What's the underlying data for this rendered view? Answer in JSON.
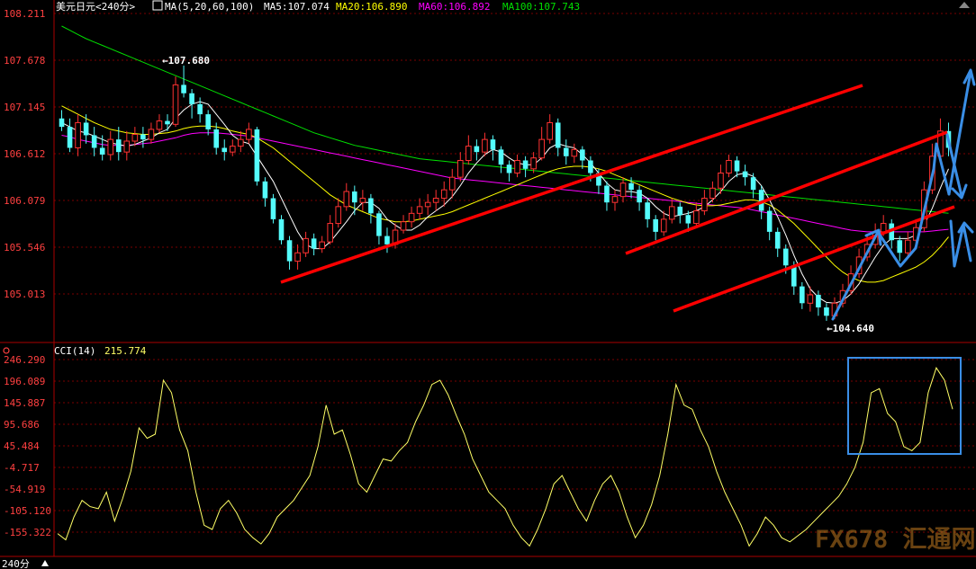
{
  "header": {
    "symbol_label": "美元日元<240分>",
    "ma_label": "MA(5,20,60,100)",
    "ma5": "MA5:107.074",
    "ma20": "MA20:106.890",
    "ma60": "MA60:106.892",
    "ma100": "MA100:107.743"
  },
  "price_axis": [
    "108.211",
    "107.678",
    "107.145",
    "106.612",
    "106.079",
    "105.546",
    "105.013"
  ],
  "annotations": {
    "high": "107.680",
    "low": "104.640"
  },
  "cci_panel": {
    "label": "CCI(14)",
    "value": "215.774",
    "axis": [
      "246.290",
      "196.089",
      "145.887",
      "95.686",
      "45.484",
      "-4.717",
      "-54.919",
      "-105.120",
      "-155.322"
    ]
  },
  "footer": {
    "period": "240分"
  },
  "watermark": "FX678 汇通网",
  "colors": {
    "up": "#ff3232",
    "down": "#54fcfc",
    "ma5": "#ffffff",
    "ma20": "#ffff00",
    "ma60": "#ff00ff",
    "ma100": "#00e000",
    "trend": "#ff0000",
    "arrow": "#3a8ee6",
    "cci": "#ffff66",
    "grid": "#7a0000",
    "axis_text": "#ff4040"
  },
  "chart_data": {
    "type": "candlestick",
    "y_range_price": [
      104.5,
      108.3
    ],
    "y_range_cci": [
      -200,
      260
    ],
    "candles": [
      [
        107.05,
        106.95,
        107.15,
        106.9
      ],
      [
        106.95,
        106.7,
        107.05,
        106.65
      ],
      [
        106.7,
        107.0,
        107.1,
        106.6
      ],
      [
        107.0,
        106.85,
        107.1,
        106.75
      ],
      [
        106.85,
        106.7,
        106.95,
        106.6
      ],
      [
        106.7,
        106.62,
        106.85,
        106.55
      ],
      [
        106.62,
        106.8,
        106.9,
        106.55
      ],
      [
        106.8,
        106.65,
        106.95,
        106.55
      ],
      [
        106.65,
        106.78,
        106.9,
        106.55
      ],
      [
        106.78,
        106.86,
        106.95,
        106.72
      ],
      [
        106.86,
        106.8,
        106.95,
        106.7
      ],
      [
        106.8,
        106.92,
        107.0,
        106.75
      ],
      [
        106.92,
        107.02,
        107.1,
        106.88
      ],
      [
        107.02,
        106.98,
        107.1,
        106.9
      ],
      [
        106.98,
        107.45,
        107.55,
        106.95
      ],
      [
        107.45,
        107.35,
        107.68,
        107.3
      ],
      [
        107.35,
        107.22,
        107.4,
        107.05
      ],
      [
        107.22,
        107.1,
        107.3,
        107.0
      ],
      [
        107.1,
        106.92,
        107.15,
        106.85
      ],
      [
        106.92,
        106.7,
        107.0,
        106.62
      ],
      [
        106.7,
        106.65,
        106.8,
        106.55
      ],
      [
        106.65,
        106.72,
        106.8,
        106.6
      ],
      [
        106.72,
        106.8,
        106.9,
        106.65
      ],
      [
        106.8,
        106.92,
        107.0,
        106.75
      ],
      [
        106.92,
        106.3,
        106.95,
        106.25
      ],
      [
        106.3,
        106.1,
        106.35,
        106.0
      ],
      [
        106.1,
        105.85,
        106.15,
        105.8
      ],
      [
        105.85,
        105.6,
        105.9,
        105.55
      ],
      [
        105.6,
        105.35,
        105.65,
        105.25
      ],
      [
        105.35,
        105.45,
        105.55,
        105.25
      ],
      [
        105.45,
        105.62,
        105.7,
        105.4
      ],
      [
        105.62,
        105.5,
        105.68,
        105.42
      ],
      [
        105.5,
        105.58,
        105.65,
        105.45
      ],
      [
        105.58,
        105.8,
        105.9,
        105.55
      ],
      [
        105.8,
        106.0,
        106.1,
        105.75
      ],
      [
        106.0,
        106.18,
        106.28,
        105.95
      ],
      [
        106.18,
        106.05,
        106.25,
        105.9
      ],
      [
        106.05,
        106.1,
        106.2,
        105.95
      ],
      [
        106.1,
        105.92,
        106.15,
        105.8
      ],
      [
        105.92,
        105.65,
        105.95,
        105.55
      ],
      [
        105.65,
        105.55,
        105.75,
        105.45
      ],
      [
        105.55,
        105.72,
        105.8,
        105.5
      ],
      [
        105.72,
        105.82,
        105.9,
        105.68
      ],
      [
        105.82,
        105.92,
        106.0,
        105.75
      ],
      [
        105.92,
        106.0,
        106.1,
        105.85
      ],
      [
        106.0,
        106.05,
        106.15,
        105.9
      ],
      [
        106.05,
        106.1,
        106.2,
        105.95
      ],
      [
        106.1,
        106.2,
        106.3,
        106.0
      ],
      [
        106.2,
        106.35,
        106.45,
        106.1
      ],
      [
        106.35,
        106.55,
        106.65,
        106.3
      ],
      [
        106.55,
        106.72,
        106.85,
        106.5
      ],
      [
        106.72,
        106.65,
        106.8,
        106.55
      ],
      [
        106.65,
        106.8,
        106.88,
        106.6
      ],
      [
        106.8,
        106.68,
        106.85,
        106.55
      ],
      [
        106.68,
        106.5,
        106.72,
        106.4
      ],
      [
        106.5,
        106.4,
        106.55,
        106.3
      ],
      [
        106.4,
        106.55,
        106.62,
        106.35
      ],
      [
        106.55,
        106.45,
        106.6,
        106.35
      ],
      [
        106.45,
        106.58,
        106.65,
        106.4
      ],
      [
        106.58,
        106.8,
        106.95,
        106.55
      ],
      [
        106.8,
        107.0,
        107.1,
        106.75
      ],
      [
        107.0,
        106.7,
        107.05,
        106.6
      ],
      [
        106.7,
        106.6,
        106.8,
        106.5
      ],
      [
        106.6,
        106.68,
        106.75,
        106.52
      ],
      [
        106.68,
        106.55,
        106.72,
        106.45
      ],
      [
        106.55,
        106.4,
        106.6,
        106.3
      ],
      [
        106.4,
        106.25,
        106.45,
        106.15
      ],
      [
        106.25,
        106.05,
        106.3,
        105.95
      ],
      [
        106.05,
        106.12,
        106.2,
        105.95
      ],
      [
        106.12,
        106.28,
        106.35,
        106.05
      ],
      [
        106.28,
        106.2,
        106.35,
        106.1
      ],
      [
        106.2,
        106.05,
        106.25,
        105.95
      ],
      [
        106.05,
        105.85,
        106.1,
        105.75
      ],
      [
        105.85,
        105.7,
        105.9,
        105.6
      ],
      [
        105.7,
        105.85,
        105.95,
        105.65
      ],
      [
        105.85,
        106.0,
        106.1,
        105.8
      ],
      [
        106.0,
        105.9,
        106.05,
        105.8
      ],
      [
        105.9,
        105.8,
        105.95,
        105.7
      ],
      [
        105.8,
        105.95,
        106.05,
        105.75
      ],
      [
        105.95,
        106.1,
        106.2,
        105.9
      ],
      [
        106.1,
        106.22,
        106.3,
        106.05
      ],
      [
        106.22,
        106.4,
        106.5,
        106.15
      ],
      [
        106.4,
        106.55,
        106.62,
        106.35
      ],
      [
        106.55,
        106.42,
        106.6,
        106.35
      ],
      [
        106.42,
        106.35,
        106.5,
        106.25
      ],
      [
        106.35,
        106.2,
        106.4,
        106.1
      ],
      [
        106.2,
        105.95,
        106.25,
        105.85
      ],
      [
        105.95,
        105.7,
        106.0,
        105.6
      ],
      [
        105.7,
        105.5,
        105.75,
        105.4
      ],
      [
        105.5,
        105.3,
        105.55,
        105.2
      ],
      [
        105.3,
        105.05,
        105.35,
        104.95
      ],
      [
        105.05,
        104.85,
        105.1,
        104.78
      ],
      [
        104.85,
        104.95,
        105.05,
        104.75
      ],
      [
        104.95,
        104.8,
        105.0,
        104.7
      ],
      [
        104.8,
        104.7,
        104.85,
        104.64
      ],
      [
        104.7,
        104.85,
        104.92,
        104.66
      ],
      [
        104.85,
        105.0,
        105.08,
        104.8
      ],
      [
        105.0,
        105.2,
        105.3,
        104.95
      ],
      [
        105.2,
        105.4,
        105.5,
        105.15
      ],
      [
        105.4,
        105.55,
        105.65,
        105.35
      ],
      [
        105.55,
        105.7,
        105.8,
        105.5
      ],
      [
        105.7,
        105.8,
        105.9,
        105.65
      ],
      [
        105.8,
        105.6,
        105.85,
        105.5
      ],
      [
        105.6,
        105.45,
        105.65,
        105.35
      ],
      [
        105.45,
        105.6,
        105.7,
        105.4
      ],
      [
        105.6,
        105.75,
        105.85,
        105.55
      ],
      [
        105.75,
        106.2,
        106.3,
        105.7
      ],
      [
        106.2,
        106.6,
        106.75,
        106.15
      ],
      [
        106.6,
        106.9,
        107.05,
        106.55
      ],
      [
        106.9,
        106.7,
        107.0,
        106.6
      ]
    ],
    "ma5": [
      107.0,
      106.95,
      106.9,
      106.88,
      106.84,
      106.8,
      106.76,
      106.74,
      106.72,
      106.74,
      106.78,
      106.82,
      106.88,
      106.92,
      107.05,
      107.15,
      107.22,
      107.25,
      107.22,
      107.1,
      106.98,
      106.85,
      106.78,
      106.75,
      106.6,
      106.45,
      106.3,
      106.1,
      105.9,
      105.7,
      105.55,
      105.5,
      105.5,
      105.58,
      105.7,
      105.82,
      105.95,
      106.05,
      106.05,
      105.98,
      105.85,
      105.78,
      105.72,
      105.72,
      105.78,
      105.88,
      105.95,
      106.02,
      106.12,
      106.25,
      106.4,
      106.52,
      106.62,
      106.68,
      106.65,
      106.58,
      106.52,
      106.5,
      106.5,
      106.58,
      106.7,
      106.75,
      106.72,
      106.7,
      106.62,
      106.52,
      106.4,
      106.28,
      106.2,
      106.18,
      106.18,
      106.16,
      106.1,
      106.0,
      105.92,
      105.88,
      105.9,
      105.92,
      105.95,
      106.0,
      106.08,
      106.18,
      106.3,
      106.38,
      106.4,
      106.36,
      106.25,
      106.08,
      105.88,
      105.66,
      105.42,
      105.2,
      105.02,
      104.92,
      104.86,
      104.85,
      104.88,
      104.96,
      105.08,
      105.24,
      105.4,
      105.54,
      105.62,
      105.62,
      105.62,
      105.66,
      105.78,
      105.98,
      106.22,
      106.45
    ],
    "ma20": [
      107.2,
      107.15,
      107.1,
      107.05,
      107.0,
      106.96,
      106.92,
      106.9,
      106.88,
      106.87,
      106.86,
      106.86,
      106.87,
      106.88,
      106.9,
      106.93,
      106.95,
      106.96,
      106.96,
      106.95,
      106.93,
      106.9,
      106.88,
      106.86,
      106.82,
      106.76,
      106.7,
      106.62,
      106.54,
      106.46,
      106.38,
      106.3,
      106.22,
      106.14,
      106.08,
      106.02,
      105.98,
      105.94,
      105.9,
      105.86,
      105.84,
      105.82,
      105.82,
      105.83,
      105.85,
      105.87,
      105.89,
      105.91,
      105.94,
      105.98,
      106.02,
      106.06,
      106.1,
      106.14,
      106.18,
      106.22,
      106.26,
      106.3,
      106.34,
      106.38,
      106.42,
      106.45,
      106.47,
      106.48,
      106.48,
      106.47,
      106.45,
      106.42,
      106.38,
      106.34,
      106.3,
      106.26,
      106.22,
      106.18,
      106.14,
      106.1,
      106.07,
      106.04,
      106.02,
      106.01,
      106.01,
      106.02,
      106.04,
      106.06,
      106.08,
      106.08,
      106.06,
      106.02,
      105.96,
      105.88,
      105.8,
      105.7,
      105.6,
      105.5,
      105.4,
      105.3,
      105.22,
      105.16,
      105.12,
      105.1,
      105.1,
      105.12,
      105.16,
      105.2,
      105.24,
      105.28,
      105.34,
      105.42,
      105.52,
      105.64
    ],
    "ma60": [
      106.85,
      106.83,
      106.8,
      106.78,
      106.76,
      106.74,
      106.73,
      106.73,
      106.73,
      106.74,
      106.75,
      106.76,
      106.78,
      106.8,
      106.82,
      106.85,
      106.87,
      106.88,
      106.88,
      106.88,
      106.87,
      106.86,
      106.85,
      106.84,
      106.82,
      106.8,
      106.78,
      106.76,
      106.74,
      106.72,
      106.7,
      106.68,
      106.66,
      106.64,
      106.62,
      106.6,
      106.58,
      106.56,
      106.54,
      106.52,
      106.5,
      106.48,
      106.46,
      106.44,
      106.42,
      106.4,
      106.38,
      106.36,
      106.34,
      106.33,
      106.32,
      106.31,
      106.3,
      106.29,
      106.28,
      106.27,
      106.26,
      106.25,
      106.24,
      106.23,
      106.22,
      106.21,
      106.2,
      106.19,
      106.18,
      106.17,
      106.16,
      106.15,
      106.14,
      106.13,
      106.12,
      106.11,
      106.1,
      106.09,
      106.08,
      106.07,
      106.06,
      106.05,
      106.04,
      106.03,
      106.02,
      106.01,
      106.0,
      105.99,
      105.98,
      105.96,
      105.94,
      105.92,
      105.9,
      105.88,
      105.86,
      105.84,
      105.82,
      105.8,
      105.78,
      105.76,
      105.74,
      105.72,
      105.71,
      105.7,
      105.7,
      105.7,
      105.7,
      105.7,
      105.7,
      105.7,
      105.7,
      105.71,
      105.72,
      105.73
    ],
    "ma100": [
      108.15,
      108.1,
      108.05,
      108.0,
      107.96,
      107.92,
      107.88,
      107.84,
      107.8,
      107.76,
      107.72,
      107.68,
      107.64,
      107.6,
      107.56,
      107.52,
      107.48,
      107.44,
      107.4,
      107.36,
      107.32,
      107.28,
      107.24,
      107.2,
      107.16,
      107.12,
      107.08,
      107.04,
      107.0,
      106.96,
      106.92,
      106.88,
      106.85,
      106.82,
      106.79,
      106.76,
      106.73,
      106.71,
      106.69,
      106.67,
      106.65,
      106.63,
      106.61,
      106.59,
      106.57,
      106.56,
      106.55,
      106.54,
      106.53,
      106.52,
      106.51,
      106.5,
      106.49,
      106.48,
      106.47,
      106.46,
      106.45,
      106.44,
      106.43,
      106.42,
      106.41,
      106.4,
      106.39,
      106.38,
      106.37,
      106.36,
      106.35,
      106.34,
      106.33,
      106.32,
      106.31,
      106.3,
      106.29,
      106.28,
      106.27,
      106.26,
      106.25,
      106.24,
      106.23,
      106.22,
      106.21,
      106.2,
      106.19,
      106.18,
      106.17,
      106.16,
      106.15,
      106.14,
      106.13,
      106.12,
      106.11,
      106.1,
      106.09,
      106.08,
      106.07,
      106.06,
      106.05,
      106.04,
      106.03,
      106.02,
      106.01,
      106.0,
      105.99,
      105.98,
      105.97,
      105.96,
      105.95,
      105.94,
      105.93,
      105.92
    ],
    "cci": [
      -160,
      -175,
      -120,
      -80,
      -95,
      -100,
      -60,
      -130,
      -75,
      -10,
      95,
      70,
      80,
      210,
      180,
      90,
      40,
      -60,
      -140,
      -150,
      -100,
      -80,
      -110,
      -150,
      -170,
      -185,
      -160,
      -120,
      -100,
      -80,
      -50,
      -20,
      50,
      150,
      80,
      90,
      30,
      -40,
      -60,
      -20,
      20,
      15,
      40,
      60,
      110,
      150,
      200,
      210,
      175,
      125,
      80,
      20,
      -20,
      -60,
      -80,
      -100,
      -140,
      -170,
      -190,
      -150,
      -100,
      -40,
      -20,
      -60,
      -100,
      -130,
      -80,
      -40,
      -20,
      -60,
      -120,
      -170,
      -140,
      -90,
      -20,
      80,
      200,
      150,
      140,
      90,
      50,
      -10,
      -60,
      -100,
      -140,
      -190,
      -160,
      -120,
      -140,
      -170,
      -180,
      -165,
      -150,
      -130,
      -110,
      -90,
      -70,
      -40,
      0,
      60,
      180,
      190,
      130,
      110,
      50,
      40,
      60,
      180,
      240,
      210,
      140
    ]
  }
}
